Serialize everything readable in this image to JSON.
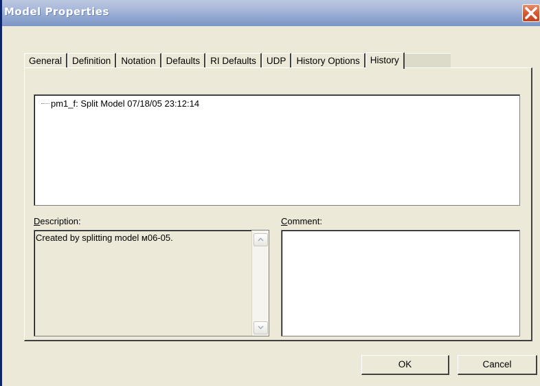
{
  "window": {
    "title": "Model Properties",
    "close_icon": "close-x-icon"
  },
  "tabs": [
    {
      "label": "General"
    },
    {
      "label": "Definition"
    },
    {
      "label": "Notation"
    },
    {
      "label": "Defaults"
    },
    {
      "label": "RI Defaults"
    },
    {
      "label": "UDP"
    },
    {
      "label": "History Options"
    },
    {
      "label": "History",
      "active": true
    }
  ],
  "history": {
    "items": [
      {
        "text": "pm1_f: Split Model 07/18/05 23:12:14"
      }
    ]
  },
  "description": {
    "label_accel": "D",
    "label_rest": "escription:",
    "value": "Created by splitting model м06-05."
  },
  "comment": {
    "label_accel": "C",
    "label_rest": "omment:",
    "value": ""
  },
  "buttons": {
    "ok": "OK",
    "cancel": "Cancel"
  },
  "colors": {
    "dialog_bg": "#ece9d8",
    "titlebar": "#8ea4cf",
    "close_button": "#d45a34"
  }
}
